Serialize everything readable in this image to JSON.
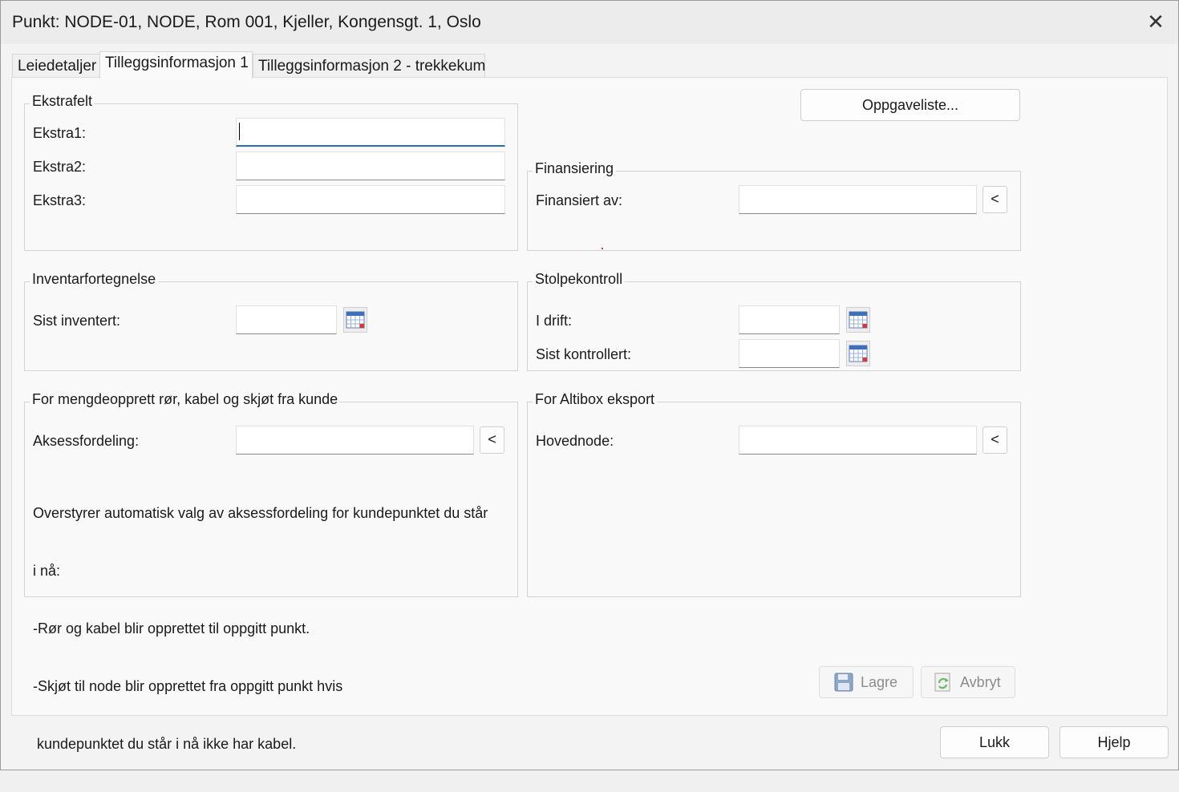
{
  "window": {
    "title": "Punkt: NODE-01, NODE, Rom 001, Kjeller, Kongensgt. 1, Oslo",
    "close_glyph": "✕"
  },
  "tabs": [
    {
      "label": "Leiedetaljer",
      "active": false
    },
    {
      "label": "Tilleggsinformasjon 1",
      "active": true
    },
    {
      "label": "Tilleggsinformasjon 2 - trekkekum",
      "active": false
    }
  ],
  "oppgaveliste_label": "Oppgaveliste...",
  "ekstrafelt": {
    "title": "Ekstrafelt",
    "fields": [
      {
        "label": "Ekstra1:",
        "value": ""
      },
      {
        "label": "Ekstra2:",
        "value": ""
      },
      {
        "label": "Ekstra3:",
        "value": ""
      }
    ]
  },
  "finansiering": {
    "title": "Finansiering",
    "label": "Finansiert av:",
    "value": "",
    "pick_label": "<"
  },
  "inventar": {
    "title": "Inventarfortegnelse",
    "label": "Sist inventert:",
    "value": ""
  },
  "stolpekontroll": {
    "title": "Stolpekontroll",
    "fields": [
      {
        "label": "I drift:",
        "value": ""
      },
      {
        "label": "Sist kontrollert:",
        "value": ""
      }
    ]
  },
  "mengde": {
    "title": "For mengdeopprett rør, kabel og skjøt fra kunde",
    "label": "Aksessfordeling:",
    "value": "",
    "pick_label": "<",
    "note_lines": [
      "Overstyrer automatisk valg av aksessfordeling for kundepunktet du står",
      "i nå:",
      "-Rør og kabel blir opprettet til oppgitt punkt.",
      "-Skjøt til node blir opprettet fra oppgitt punkt hvis",
      " kundepunktet du står i nå ikke har kabel."
    ]
  },
  "altibox": {
    "title": "For Altibox eksport",
    "label": "Hovednode:",
    "value": "",
    "pick_label": "<"
  },
  "actions": {
    "save_label": "Lagre",
    "cancel_label": "Avbryt"
  },
  "footer": {
    "close_label": "Lukk",
    "help_label": "Hjelp"
  }
}
